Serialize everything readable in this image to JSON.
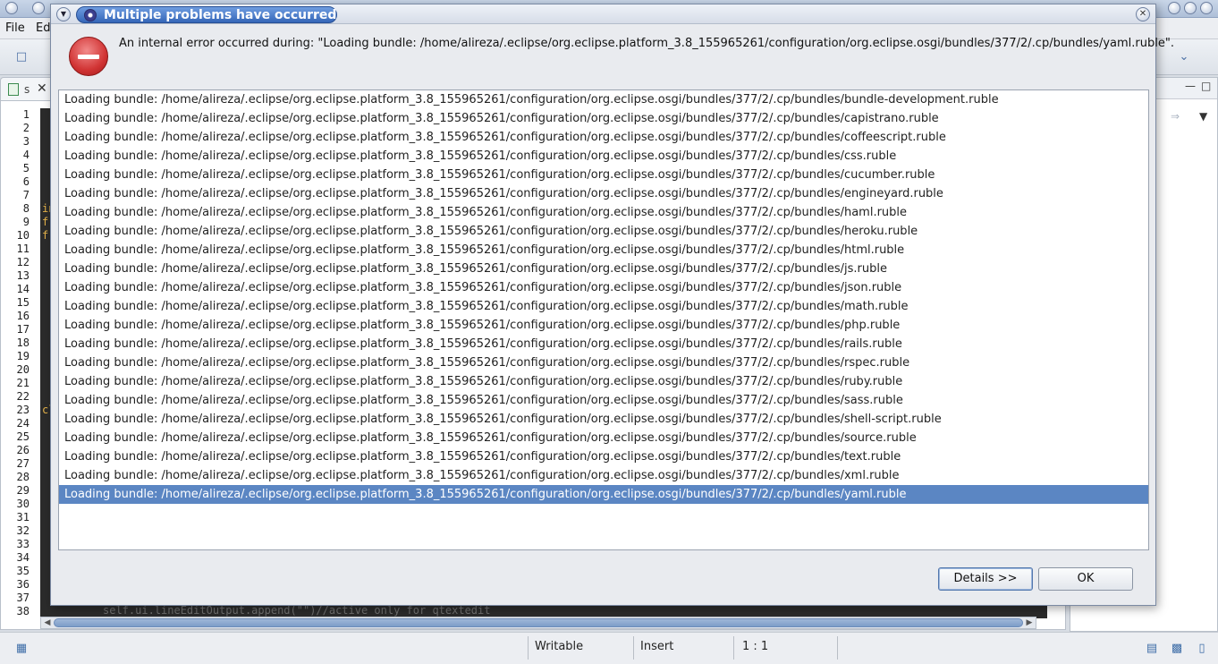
{
  "ide": {
    "menu": {
      "file": "File",
      "edit_partial": "Ed"
    },
    "editor_tab": {
      "label": "s"
    },
    "line_numbers": [
      "1",
      "2",
      "3",
      "4",
      "5",
      "6",
      "7",
      "8",
      "9",
      "10",
      "11",
      "12",
      "13",
      "14",
      "15",
      "16",
      "17",
      "18",
      "19",
      "20",
      "21",
      "22",
      "23",
      "24",
      "25",
      "26",
      "27",
      "28",
      "29",
      "30",
      "31",
      "32",
      "33",
      "34",
      "35",
      "36",
      "37",
      "38"
    ],
    "code_fragments": [
      {
        "line": 8,
        "text": "in",
        "color": "#e6b34a"
      },
      {
        "line": 9,
        "text": "fr",
        "color": "#e6b34a"
      },
      {
        "line": 10,
        "text": "fr",
        "color": "#e6b34a"
      },
      {
        "line": 23,
        "text": "cl",
        "color": "#e6b34a"
      }
    ],
    "bottom_code_text": "self.ui.lineEditOutput.append(\"\")//active only for qtextedit",
    "status": {
      "writable": "Writable",
      "insert": "Insert",
      "position": "1 : 1"
    },
    "colors": {
      "code_bg": "#2b2b2b",
      "selection": "#5b86c3"
    }
  },
  "dialog": {
    "title": "Multiple problems have occurred",
    "message": "An internal error occurred during: \"Loading bundle: /home/alireza/.eclipse/org.eclipse.platform_3.8_155965261/configuration/org.eclipse.osgi/bundles/377/2/.cp/bundles/yaml.ruble\".",
    "problems": [
      "Loading bundle: /home/alireza/.eclipse/org.eclipse.platform_3.8_155965261/configuration/org.eclipse.osgi/bundles/377/2/.cp/bundles/bundle-development.ruble",
      "Loading bundle: /home/alireza/.eclipse/org.eclipse.platform_3.8_155965261/configuration/org.eclipse.osgi/bundles/377/2/.cp/bundles/capistrano.ruble",
      "Loading bundle: /home/alireza/.eclipse/org.eclipse.platform_3.8_155965261/configuration/org.eclipse.osgi/bundles/377/2/.cp/bundles/coffeescript.ruble",
      "Loading bundle: /home/alireza/.eclipse/org.eclipse.platform_3.8_155965261/configuration/org.eclipse.osgi/bundles/377/2/.cp/bundles/css.ruble",
      "Loading bundle: /home/alireza/.eclipse/org.eclipse.platform_3.8_155965261/configuration/org.eclipse.osgi/bundles/377/2/.cp/bundles/cucumber.ruble",
      "Loading bundle: /home/alireza/.eclipse/org.eclipse.platform_3.8_155965261/configuration/org.eclipse.osgi/bundles/377/2/.cp/bundles/engineyard.ruble",
      "Loading bundle: /home/alireza/.eclipse/org.eclipse.platform_3.8_155965261/configuration/org.eclipse.osgi/bundles/377/2/.cp/bundles/haml.ruble",
      "Loading bundle: /home/alireza/.eclipse/org.eclipse.platform_3.8_155965261/configuration/org.eclipse.osgi/bundles/377/2/.cp/bundles/heroku.ruble",
      "Loading bundle: /home/alireza/.eclipse/org.eclipse.platform_3.8_155965261/configuration/org.eclipse.osgi/bundles/377/2/.cp/bundles/html.ruble",
      "Loading bundle: /home/alireza/.eclipse/org.eclipse.platform_3.8_155965261/configuration/org.eclipse.osgi/bundles/377/2/.cp/bundles/js.ruble",
      "Loading bundle: /home/alireza/.eclipse/org.eclipse.platform_3.8_155965261/configuration/org.eclipse.osgi/bundles/377/2/.cp/bundles/json.ruble",
      "Loading bundle: /home/alireza/.eclipse/org.eclipse.platform_3.8_155965261/configuration/org.eclipse.osgi/bundles/377/2/.cp/bundles/math.ruble",
      "Loading bundle: /home/alireza/.eclipse/org.eclipse.platform_3.8_155965261/configuration/org.eclipse.osgi/bundles/377/2/.cp/bundles/php.ruble",
      "Loading bundle: /home/alireza/.eclipse/org.eclipse.platform_3.8_155965261/configuration/org.eclipse.osgi/bundles/377/2/.cp/bundles/rails.ruble",
      "Loading bundle: /home/alireza/.eclipse/org.eclipse.platform_3.8_155965261/configuration/org.eclipse.osgi/bundles/377/2/.cp/bundles/rspec.ruble",
      "Loading bundle: /home/alireza/.eclipse/org.eclipse.platform_3.8_155965261/configuration/org.eclipse.osgi/bundles/377/2/.cp/bundles/ruby.ruble",
      "Loading bundle: /home/alireza/.eclipse/org.eclipse.platform_3.8_155965261/configuration/org.eclipse.osgi/bundles/377/2/.cp/bundles/sass.ruble",
      "Loading bundle: /home/alireza/.eclipse/org.eclipse.platform_3.8_155965261/configuration/org.eclipse.osgi/bundles/377/2/.cp/bundles/shell-script.ruble",
      "Loading bundle: /home/alireza/.eclipse/org.eclipse.platform_3.8_155965261/configuration/org.eclipse.osgi/bundles/377/2/.cp/bundles/source.ruble",
      "Loading bundle: /home/alireza/.eclipse/org.eclipse.platform_3.8_155965261/configuration/org.eclipse.osgi/bundles/377/2/.cp/bundles/text.ruble",
      "Loading bundle: /home/alireza/.eclipse/org.eclipse.platform_3.8_155965261/configuration/org.eclipse.osgi/bundles/377/2/.cp/bundles/xml.ruble",
      "Loading bundle: /home/alireza/.eclipse/org.eclipse.platform_3.8_155965261/configuration/org.eclipse.osgi/bundles/377/2/.cp/bundles/yaml.ruble"
    ],
    "selected_index": 21,
    "buttons": {
      "details": "Details >>",
      "ok": "OK"
    }
  }
}
